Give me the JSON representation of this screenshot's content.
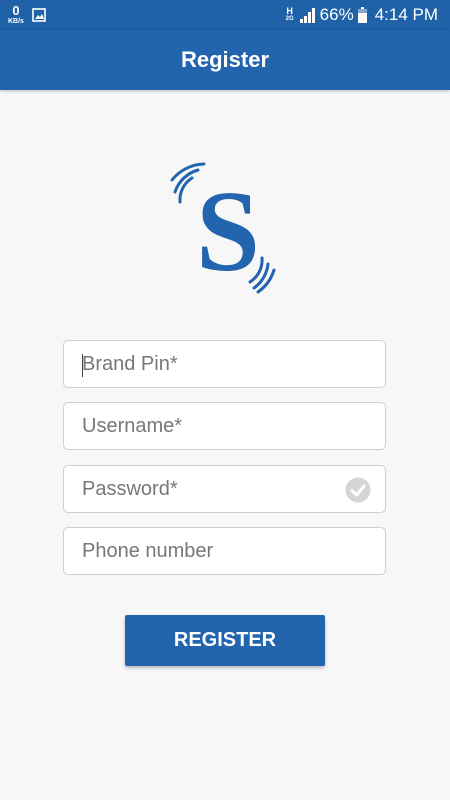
{
  "status_bar": {
    "data_speed": "0",
    "data_unit": "KB/s",
    "network_type": "H",
    "network_sub": "2G",
    "battery_percent": "66%",
    "time": "4:14 PM"
  },
  "header": {
    "title": "Register"
  },
  "form": {
    "brand_pin_placeholder": "Brand Pin*",
    "username_placeholder": "Username*",
    "password_placeholder": "Password*",
    "phone_placeholder": "Phone number",
    "register_label": "REGISTER"
  },
  "colors": {
    "primary": "#2264ad",
    "status_bar": "#1f62a8",
    "background": "#f7f7f7"
  },
  "icons": {
    "gallery": "image-icon",
    "signal": "signal-icon",
    "battery": "battery-icon",
    "logo": "brand-s-logo",
    "password_check": "check-circle-icon"
  }
}
